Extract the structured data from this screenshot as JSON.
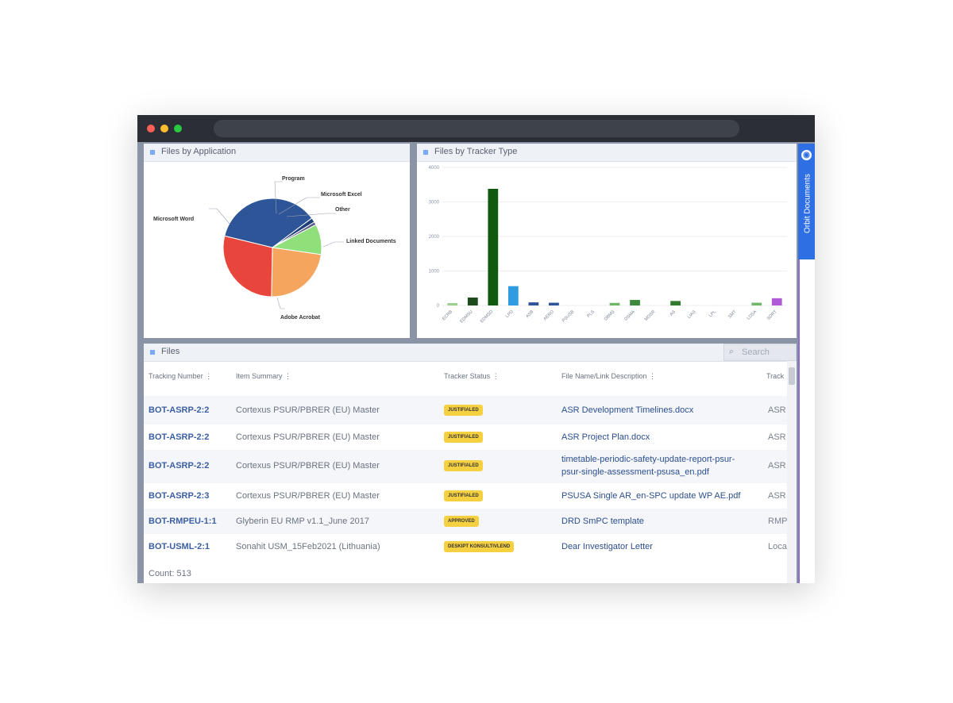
{
  "panels": {
    "app": {
      "title": "Files by Application"
    },
    "tracker": {
      "title": "Files by Tracker Type"
    },
    "files": {
      "title": "Files"
    }
  },
  "sidetab": {
    "label": "Orbit Documents"
  },
  "search": {
    "placeholder": "Search"
  },
  "pie": {
    "labels": [
      "Program",
      "Microsoft Excel",
      "Other",
      "Microsoft Word",
      "Linked Documents",
      "Adobe Acrobat"
    ],
    "slices": [
      {
        "name": "Microsoft Word",
        "value": 36,
        "color": "#2d5597"
      },
      {
        "name": "Program",
        "value": 1.5,
        "color": "#1f3f7a"
      },
      {
        "name": "Microsoft Excel",
        "value": 1,
        "color": "#5b5e8d"
      },
      {
        "name": "Other",
        "value": 10,
        "color": "#8fe07a"
      },
      {
        "name": "Linked Documents",
        "value": 23,
        "color": "#f5a55d"
      },
      {
        "name": "Adobe Acrobat",
        "value": 28.5,
        "color": "#e8463c"
      }
    ]
  },
  "chart_data": {
    "type": "bar",
    "y_ticks": [
      "4000",
      "3000",
      "2000",
      "1000",
      "0"
    ],
    "ylim": [
      0,
      4000
    ],
    "categories": [
      "ECRB",
      "EDMSU",
      "EDMSD",
      "LPD",
      "ASB",
      "AERO",
      "PSUSB",
      "PLS",
      "DBMS",
      "DSMA",
      "MDSR",
      "AS",
      "LIAS",
      "LPL",
      "SMT",
      "LDSA",
      "SDRT"
    ],
    "values": [
      70,
      230,
      3380,
      560,
      90,
      80,
      0,
      0,
      75,
      160,
      0,
      130,
      0,
      0,
      0,
      80,
      210
    ],
    "colors": [
      "#9bd28f",
      "#1c4b1c",
      "#0f5a0f",
      "#2f9be0",
      "#2d5597",
      "#2d5597",
      "#cccccc",
      "#cccccc",
      "#6fb86a",
      "#3d8a3d",
      "#cccccc",
      "#2f7a2f",
      "#cccccc",
      "#cccccc",
      "#cccccc",
      "#6fb86a",
      "#b05ad8"
    ]
  },
  "table": {
    "headers": [
      "Tracking Number",
      "Item Summary",
      "Tracker Status",
      "File Name/Link Description",
      "Track"
    ],
    "rows": [
      {
        "track": "BOT-ASRP-2:2",
        "summary": "Cortexus PSUR/PBRER (EU) Master",
        "status": "JUSTIFIALED",
        "file": "ASR Development Timelines.docx",
        "type": "ASR"
      },
      {
        "track": "BOT-ASRP-2:2",
        "summary": "Cortexus PSUR/PBRER (EU) Master",
        "status": "JUSTIFIALED",
        "file": "ASR Project Plan.docx",
        "type": "ASR"
      },
      {
        "track": "BOT-ASRP-2:2",
        "summary": "Cortexus PSUR/PBRER (EU) Master",
        "status": "JUSTIFIALED",
        "file": "timetable-periodic-safety-update-report-psur-psur-single-assessment-psusa_en.pdf",
        "file_line1": "timetable-periodic-safety-update-report-psur-",
        "file_line2": "psur-single-assessment-psusa_en.pdf",
        "type": "ASR"
      },
      {
        "track": "BOT-ASRP-2:3",
        "summary": "Cortexus PSUR/PBRER (EU) Master",
        "status": "JUSTIFIALED",
        "file": "PSUSA Single AR_en-SPC update WP AE.pdf",
        "type": "ASR"
      },
      {
        "track": "BOT-RMPEU-1:1",
        "summary": "Glyberin EU RMP v1.1_June 2017",
        "status": "APPROVED",
        "file": "DRD SmPC template",
        "type": "RMP"
      },
      {
        "track": "BOT-USML-2:1",
        "summary": "Sonahit USM_15Feb2021 (Lithuania)",
        "status": "DESKIPT KONSULTIVLEND",
        "file": "Dear Investigator Letter",
        "type": "Loca"
      }
    ],
    "count": "Count: 513"
  }
}
